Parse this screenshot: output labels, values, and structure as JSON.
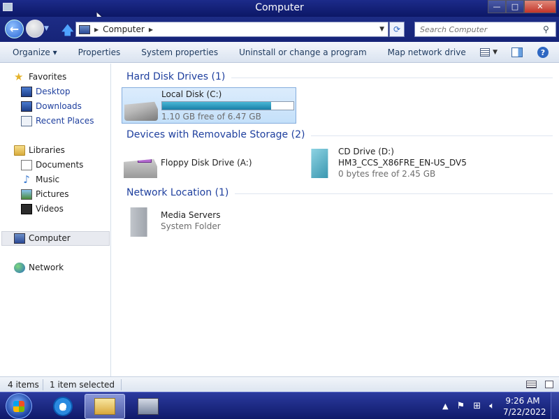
{
  "window": {
    "title": "Computer",
    "min_label": "—",
    "max_label": "□",
    "close_label": "✕"
  },
  "nav": {
    "back_glyph": "←",
    "up_glyph": "🡅",
    "address": "Computer",
    "refresh_glyph": "⟳",
    "search_placeholder": "Search Computer"
  },
  "toolbar": {
    "items": [
      "Organize ▾",
      "Properties",
      "System properties",
      "Uninstall or change a program",
      "Map network drive"
    ],
    "more": "»",
    "help_glyph": "?"
  },
  "sidebar": {
    "favorites": "Favorites",
    "desktop": "Desktop",
    "downloads": "Downloads",
    "recent": "Recent Places",
    "libraries": "Libraries",
    "documents": "Documents",
    "music": "Music",
    "pictures": "Pictures",
    "videos": "Videos",
    "computer": "Computer",
    "network": "Network"
  },
  "groups": {
    "hdd": "Hard Disk Drives (1)",
    "removable": "Devices with Removable Storage (2)",
    "network": "Network Location (1)"
  },
  "items": {
    "local_disk": {
      "name": "Local Disk (C:)",
      "free": "1.10 GB free of 6.47 GB",
      "used_fraction": 0.83
    },
    "floppy": {
      "name": "Floppy Disk Drive (A:)"
    },
    "cd": {
      "name": "CD Drive (D:)",
      "label": "HM3_CCS_X86FRE_EN-US_DV5",
      "free": "0 bytes free of 2.45 GB"
    },
    "media": {
      "name": "Media Servers",
      "type": "System Folder"
    }
  },
  "status": {
    "count": "4 items",
    "selected": "1 item selected"
  },
  "taskbar": {
    "time": "9:26 AM",
    "date": "7/22/2022",
    "tray_arrow": "▲"
  },
  "colors": {
    "accent": "#1e3f9e",
    "titlebar": "#0c1766",
    "selection": "#c4e0fa",
    "capacity_bar": "#1a7fa8"
  }
}
